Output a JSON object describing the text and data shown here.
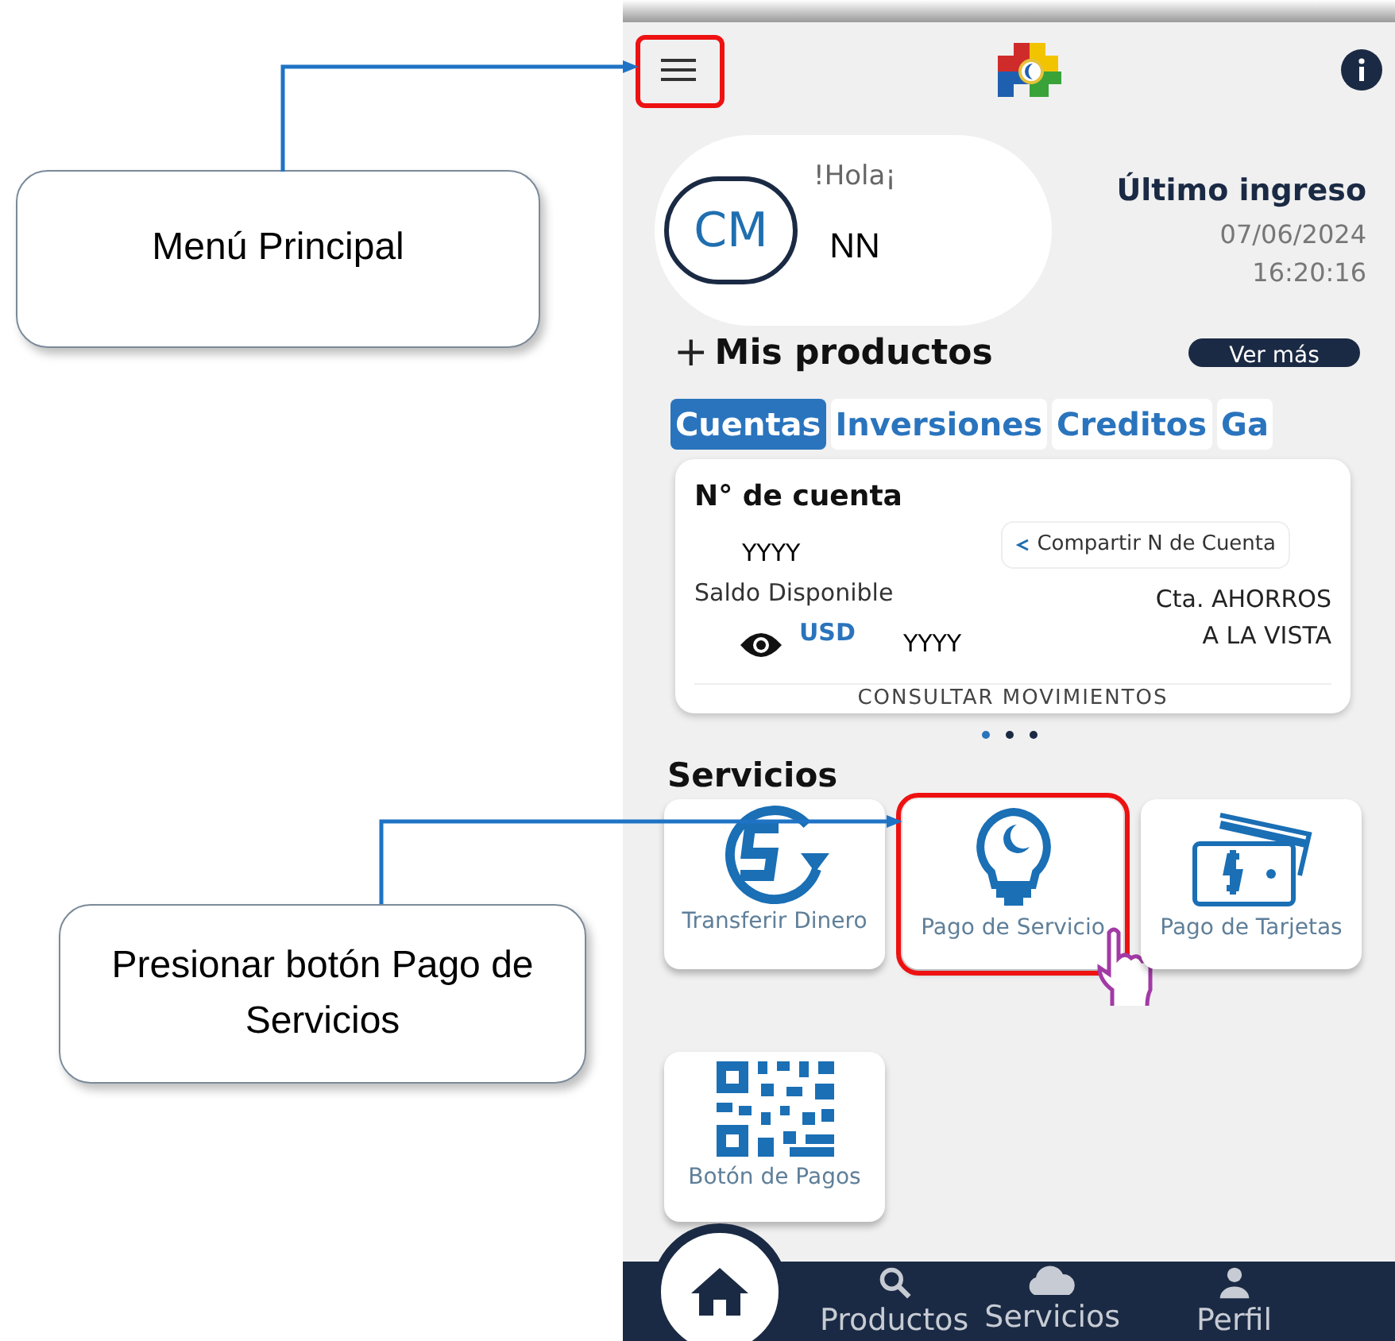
{
  "callouts": [
    {
      "text": "Menú Principal"
    },
    {
      "text": "Presionar botón Pago de Servicios"
    }
  ],
  "header": {
    "menu_highlighted": true
  },
  "greeting": {
    "initials": "CM",
    "hello": "!Hola¡",
    "name": "NN"
  },
  "last_login": {
    "title": "Último ingreso",
    "date": "07/06/2024",
    "time": "16:20:16"
  },
  "products": {
    "prefix": "+",
    "title": "Mis productos",
    "more": "Ver más",
    "tabs": [
      {
        "label": "Cuentas",
        "selected": true
      },
      {
        "label": "Inversiones",
        "selected": false
      },
      {
        "label": "Creditos",
        "selected": false
      },
      {
        "label": "Ga",
        "selected": false
      }
    ],
    "account": {
      "title": "N° de cuenta",
      "number": "YYYY",
      "share": "Compartir N de Cuenta",
      "balance_label": "Saldo Disponible",
      "currency": "USD",
      "balance": "YYYY",
      "type_line1": "Cta. AHORROS",
      "type_line2": "A LA VISTA",
      "action": "CONSULTAR MOVIMIENTOS"
    },
    "pager": [
      {
        "selected": true
      },
      {
        "selected": false
      },
      {
        "selected": false
      }
    ]
  },
  "services": {
    "title": "Servicios",
    "items": [
      {
        "kind": "transfer",
        "label": "Transferir Dinero",
        "highlighted": false
      },
      {
        "kind": "bulb",
        "label": "Pago de Servicio",
        "highlighted": true
      },
      {
        "kind": "card",
        "label": "Pago de Tarjetas",
        "highlighted": false
      },
      {
        "kind": "qr",
        "label": "Botón de Pagos",
        "highlighted": false
      }
    ]
  },
  "nav": [
    {
      "kind": "home",
      "selected": true
    },
    {
      "kind": "search",
      "label": "Productos",
      "selected": false
    },
    {
      "kind": "cloud",
      "label": "Servicios",
      "selected": false
    },
    {
      "kind": "user",
      "label": "Perfil",
      "selected": false
    }
  ]
}
